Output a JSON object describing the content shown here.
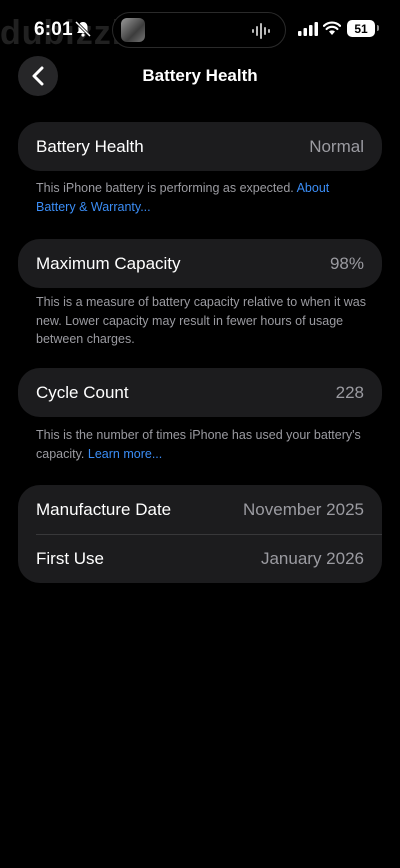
{
  "status_bar": {
    "time": "6:01",
    "battery_level": "51",
    "watermark": "dubizzle",
    "icons": [
      "bell-slash-icon",
      "signal-icon",
      "wifi-icon",
      "battery-icon",
      "audio-wave-icon"
    ]
  },
  "nav": {
    "title": "Battery Health",
    "back_icon": "chevron-left-icon"
  },
  "sections": {
    "health": {
      "label": "Battery Health",
      "value": "Normal",
      "footnote": "This iPhone battery is performing as expected.",
      "link": "About Battery & Warranty..."
    },
    "capacity": {
      "label": "Maximum Capacity",
      "value": "98%",
      "footnote": "This is a measure of battery capacity relative to when it was new. Lower capacity may result in fewer hours of usage between charges."
    },
    "cycles": {
      "label": "Cycle Count",
      "value": "228",
      "footnote": "This is the number of times iPhone has used your battery's capacity.",
      "link": "Learn more..."
    },
    "dates": {
      "manufacture_label": "Manufacture Date",
      "manufacture_value": "November 2025",
      "first_use_label": "First Use",
      "first_use_value": "January 2026"
    }
  },
  "colors": {
    "background": "#000000",
    "card": "#1c1c1e",
    "secondary_text": "#9b9ba1",
    "link": "#3b8df5"
  }
}
